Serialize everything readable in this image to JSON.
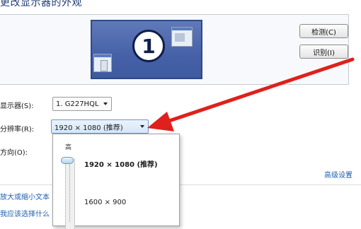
{
  "title": "更改显示器的外观",
  "preview": {
    "monitor_number": "1"
  },
  "buttons": {
    "detect": "检测(C)",
    "identify": "识别(I)"
  },
  "fields": {
    "display_label": "显示器(S):",
    "display_value": "1. G227HQL",
    "resolution_label": "分辨率(R):",
    "resolution_value": "1920 × 1080 (推荐)",
    "orientation_label": "方向(O):"
  },
  "dropdown": {
    "top_label": "高",
    "options": [
      "1920 × 1080 (推荐)",
      "1600 × 900"
    ],
    "selected_index": 0
  },
  "links": {
    "advanced": "高级设置",
    "text_size": "放大或缩小文本",
    "help": "我应该选择什么"
  },
  "colors": {
    "arrow": "#e0201c",
    "monitor": "#4661a8",
    "link": "#1d5fb0"
  }
}
